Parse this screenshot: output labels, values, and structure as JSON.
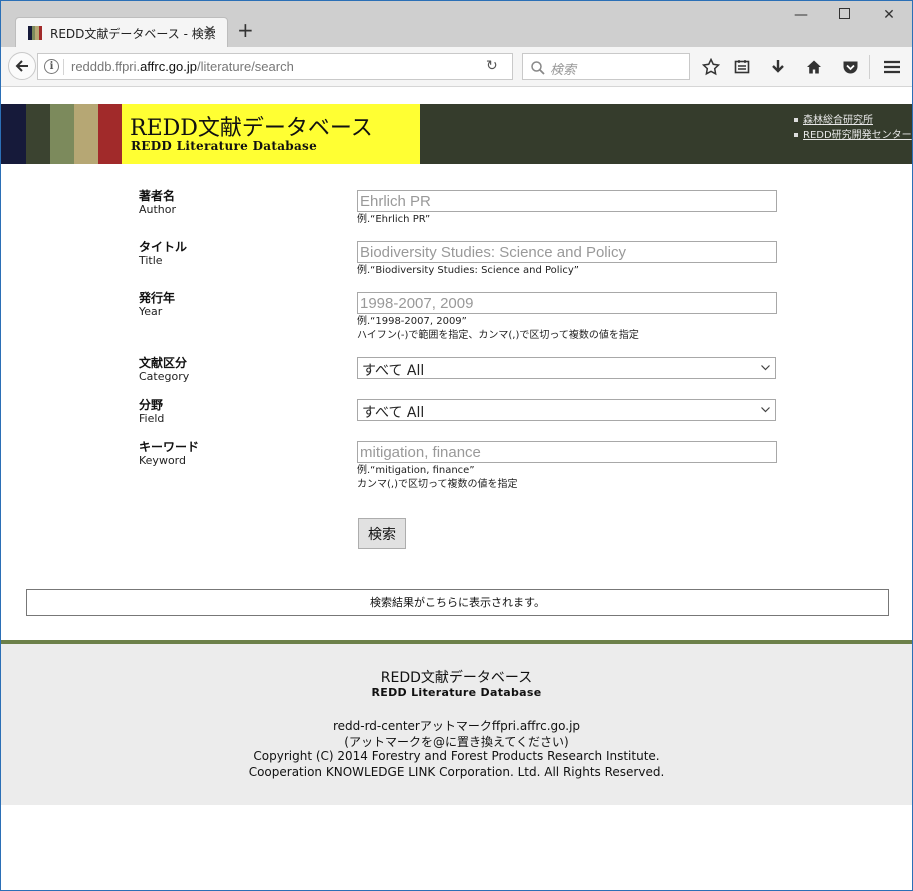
{
  "browser": {
    "tab_title": "REDD文献データベース - 検索",
    "url_prefix": "redddb.ffpri.",
    "url_domain": "affrc.go.jp",
    "url_path": "/literature/search",
    "search_placeholder": "検索"
  },
  "header": {
    "logo_jp": "REDD文献データベース",
    "logo_en": "REDD Literature Database",
    "links": [
      "森林総合研究所",
      "REDD研究開発センター"
    ],
    "stripe_colors": [
      "#161a3a",
      "#3b4330",
      "#7c8a5c",
      "#b6a774",
      "#a12a2a"
    ]
  },
  "form": {
    "author": {
      "label_jp": "著者名",
      "label_en": "Author",
      "placeholder": "Ehrlich PR",
      "hint": "例.“Ehrlich PR”"
    },
    "title": {
      "label_jp": "タイトル",
      "label_en": "Title",
      "placeholder": "Biodiversity Studies: Science and Policy",
      "hint": "例.“Biodiversity Studies: Science and Policy”"
    },
    "year": {
      "label_jp": "発行年",
      "label_en": "Year",
      "placeholder": "1998-2007, 2009",
      "hint": "例.“1998-2007, 2009”",
      "hint2": "ハイフン(-)で範囲を指定、カンマ(,)で区切って複数の値を指定"
    },
    "category": {
      "label_jp": "文献区分",
      "label_en": "Category",
      "selected": "すべて All"
    },
    "field": {
      "label_jp": "分野",
      "label_en": "Field",
      "selected": "すべて All"
    },
    "keyword": {
      "label_jp": "キーワード",
      "label_en": "Keyword",
      "placeholder": "mitigation, finance",
      "hint": "例.“mitigation, finance”",
      "hint2": "カンマ(,)で区切って複数の値を指定"
    },
    "submit_label": "検索"
  },
  "results_text": "検索結果がこちらに表示されます。",
  "footer": {
    "title": "REDD文献データベース",
    "subtitle": "REDD Literature Database",
    "email": "redd-rd-centerアットマークffpri.affrc.go.jp",
    "email_note": "(アットマークを@に置き換えてください)",
    "copyright": "Copyright (C) 2014 Forestry and Forest Products Research Institute.",
    "cooperation": "Cooperation KNOWLEDGE LINK Corporation. Ltd. All Rights Reserved."
  }
}
